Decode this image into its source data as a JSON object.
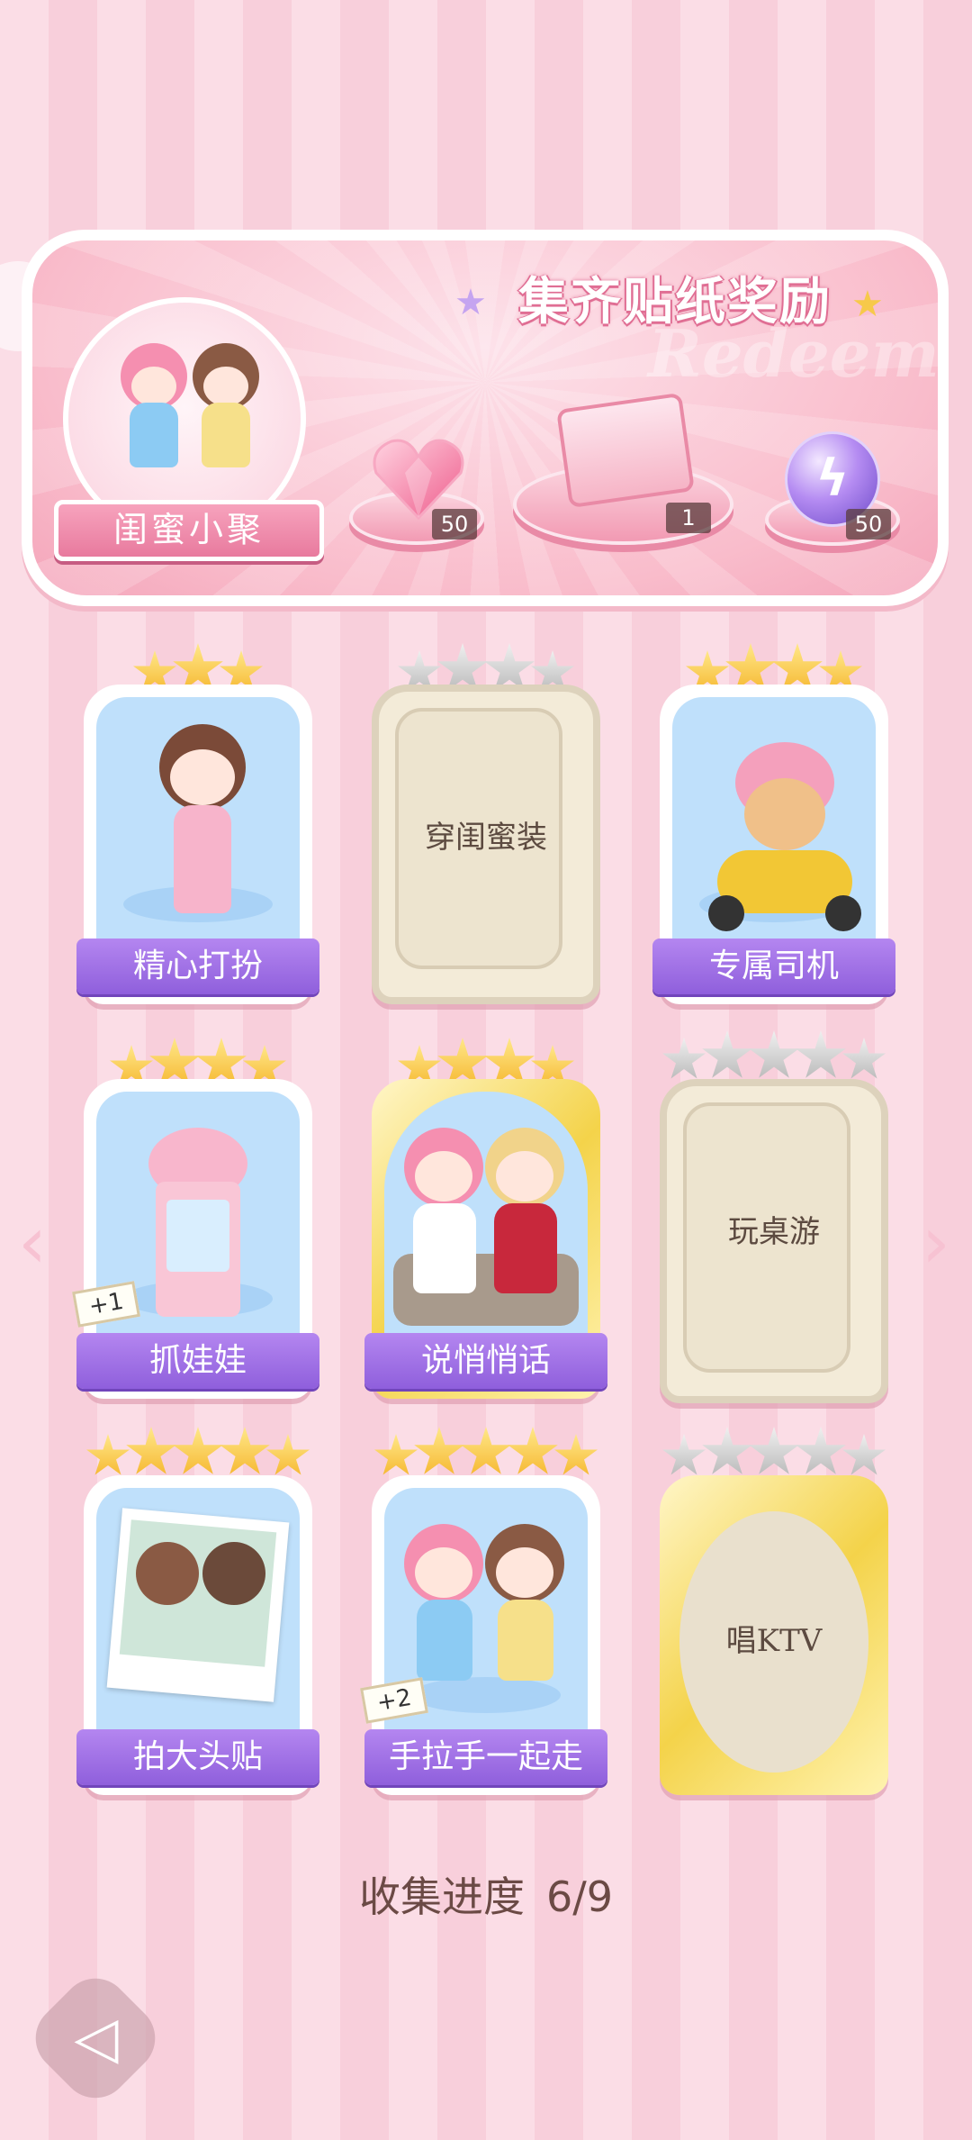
{
  "banner": {
    "title": "集齐贴纸奖励",
    "deco_text": "Redeem",
    "badge_label": "闺蜜小聚",
    "rewards": [
      {
        "icon": "pink-heart-gem-icon",
        "count": "50"
      },
      {
        "icon": "gift-box-icon",
        "count": "1"
      },
      {
        "icon": "lightning-orb-icon",
        "count": "50"
      }
    ]
  },
  "stickers": [
    {
      "label": "精心打扮",
      "stars": 3,
      "max_stars": 3,
      "collected": true,
      "rare": false,
      "badge": ""
    },
    {
      "label": "穿闺蜜装",
      "stars": 0,
      "max_stars": 4,
      "collected": false,
      "rare": false,
      "badge": ""
    },
    {
      "label": "专属司机",
      "stars": 4,
      "max_stars": 4,
      "collected": true,
      "rare": false,
      "badge": ""
    },
    {
      "label": "抓娃娃",
      "stars": 4,
      "max_stars": 4,
      "collected": true,
      "rare": false,
      "badge": "+1"
    },
    {
      "label": "说悄悄话",
      "stars": 4,
      "max_stars": 4,
      "collected": true,
      "rare": true,
      "badge": ""
    },
    {
      "label": "玩桌游",
      "stars": 0,
      "max_stars": 5,
      "collected": false,
      "rare": false,
      "badge": ""
    },
    {
      "label": "拍大头贴",
      "stars": 5,
      "max_stars": 5,
      "collected": true,
      "rare": false,
      "badge": ""
    },
    {
      "label": "手拉手一起走",
      "stars": 5,
      "max_stars": 5,
      "collected": true,
      "rare": false,
      "badge": "+2"
    },
    {
      "label": "唱KTV",
      "stars": 0,
      "max_stars": 5,
      "collected": false,
      "rare": true,
      "badge": ""
    }
  ],
  "progress": {
    "label": "收集进度",
    "value": "6/9"
  },
  "nav": {
    "prev_icon": "chevron-left-icon",
    "next_icon": "chevron-right-icon",
    "back_icon": "back-icon"
  },
  "colors": {
    "label_purple": "#9a6ae3",
    "banner_pink": "#f7b6c7",
    "star_gold": "#f5b52c",
    "star_gray": "#b7b7b7"
  }
}
